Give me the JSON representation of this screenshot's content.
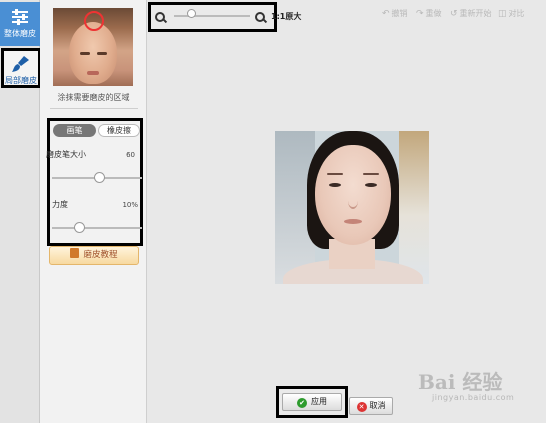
{
  "rail": {
    "global_label": "整体磨皮",
    "local_label": "局部磨皮"
  },
  "panel": {
    "hint": "涂抹需要磨皮的区域",
    "tabs": {
      "brush": "画笔",
      "eraser": "橡皮擦"
    },
    "brush_size": {
      "label": "磨皮笔大小",
      "value": "60",
      "level": 0.6
    },
    "strength": {
      "label": "力度",
      "value": "10%",
      "level": 0.1
    },
    "tutorial": "磨皮教程"
  },
  "zoom": {
    "label": "1:1原大"
  },
  "toolbar": {
    "undo": "撤销",
    "redo": "重做",
    "restart": "重新开始",
    "compare": "对比"
  },
  "actions": {
    "apply": "应用",
    "cancel": "取消"
  },
  "watermark": {
    "main": "Bai 经验",
    "sub": "jingyan.baidu.com"
  },
  "colors": {
    "accent": "#4a8fd4",
    "apply_icon": "#2e9b2e",
    "cancel_icon": "#dd3333"
  }
}
